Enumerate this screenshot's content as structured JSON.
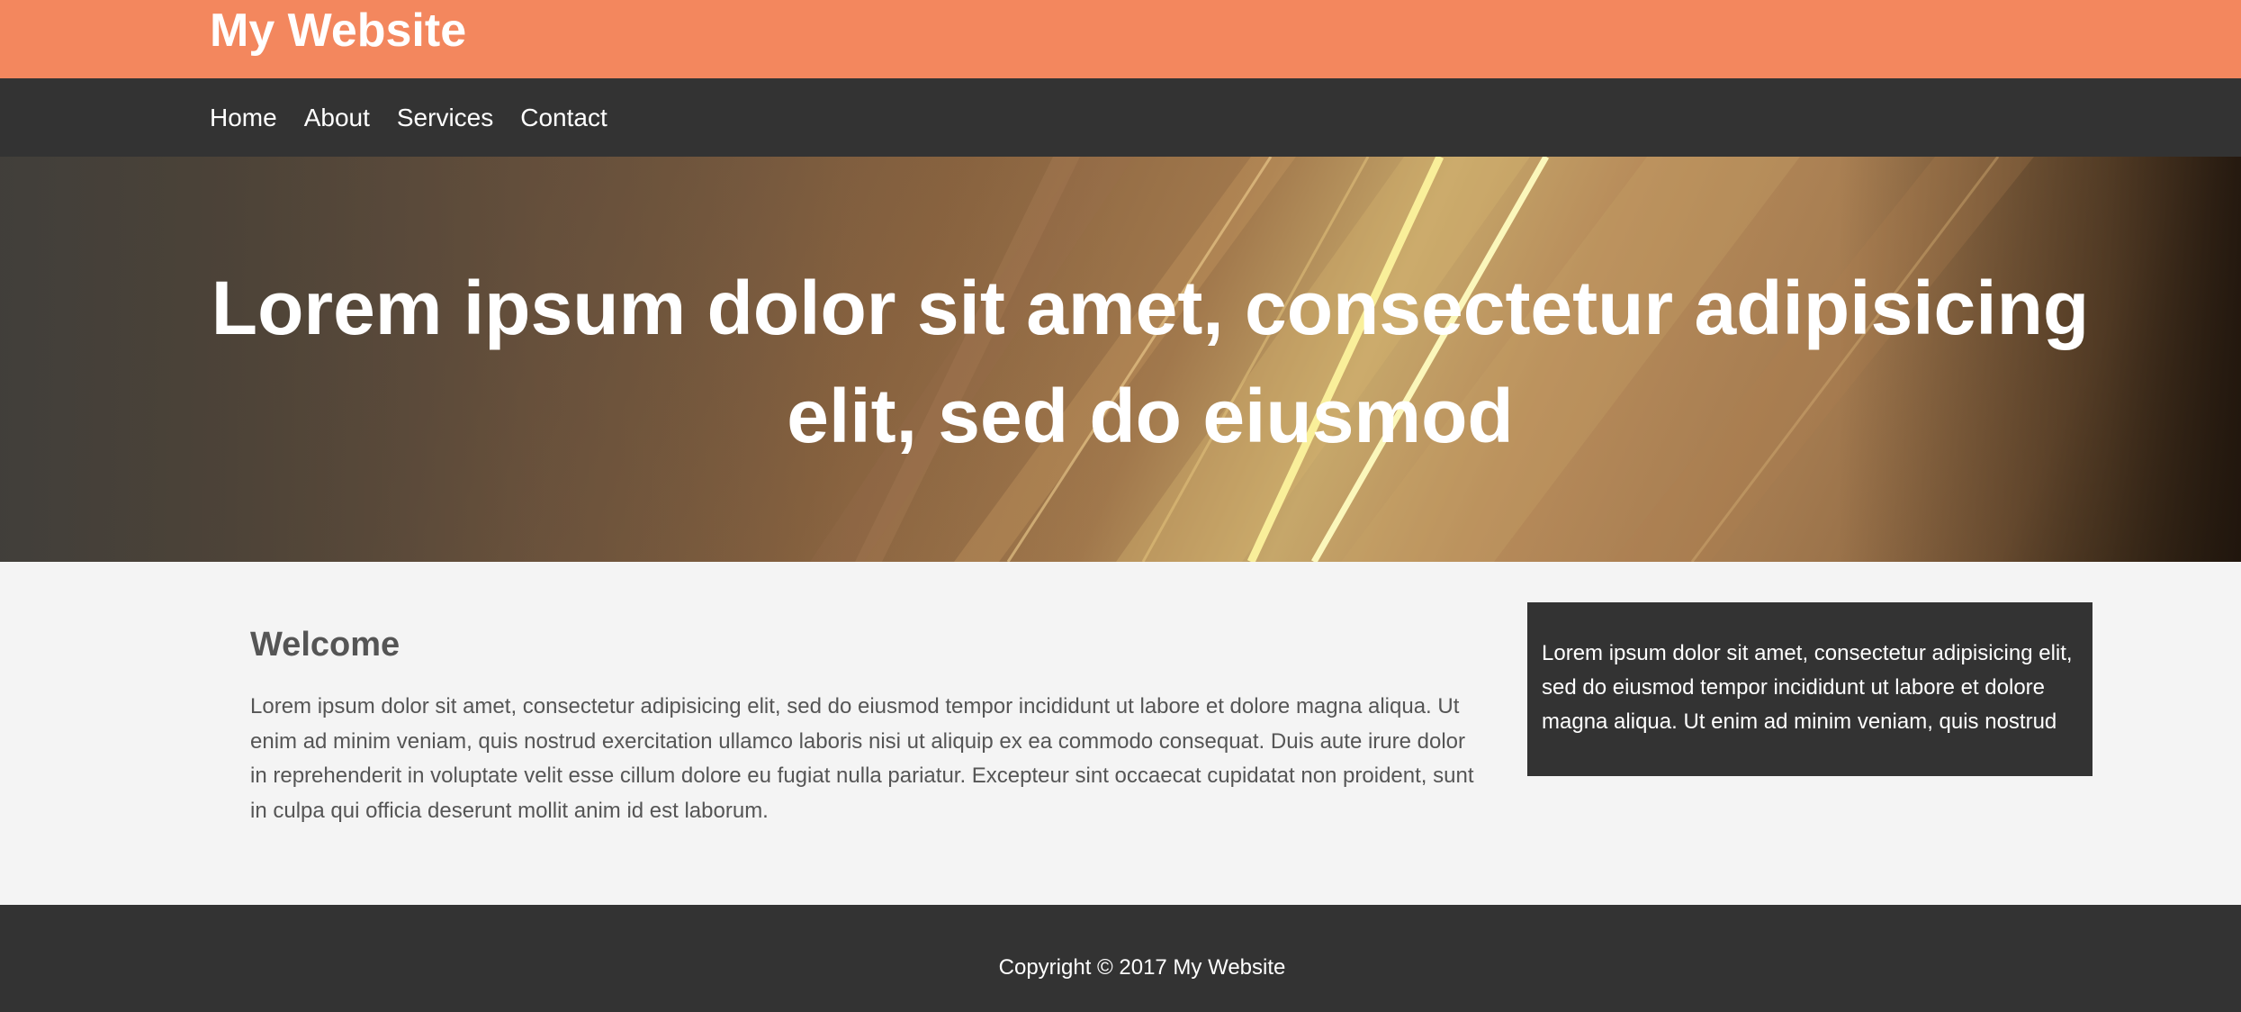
{
  "header": {
    "site_title": "My Website"
  },
  "nav": {
    "items": [
      {
        "label": "Home"
      },
      {
        "label": "About"
      },
      {
        "label": "Services"
      },
      {
        "label": "Contact"
      }
    ]
  },
  "hero": {
    "title": "Lorem ipsum dolor sit amet, consectetur adipisicing elit, sed do eiusmod"
  },
  "main": {
    "heading": "Welcome",
    "body": "Lorem ipsum dolor sit amet, consectetur adipisicing elit, sed do eiusmod tempor incididunt ut labore et dolore magna aliqua. Ut enim ad minim veniam, quis nostrud exercitation ullamco laboris nisi ut aliquip ex ea commodo consequat. Duis aute irure dolor in reprehenderit in voluptate velit esse cillum dolore eu fugiat nulla pariatur. Excepteur sint occaecat cupidatat non proident, sunt in culpa qui officia deserunt mollit anim id est laborum."
  },
  "sidebar": {
    "text": "Lorem ipsum dolor sit amet, consectetur adipisicing elit, sed do eiusmod tempor incididunt ut labore et dolore magna aliqua. Ut enim ad minim veniam, quis nostrud"
  },
  "footer": {
    "copyright": "Copyright © 2017 My Website"
  },
  "colors": {
    "header_bg": "#f3875e",
    "nav_bg": "#333333",
    "page_bg": "#f4f4f4",
    "text": "#555555",
    "footer_bg": "#333333"
  }
}
